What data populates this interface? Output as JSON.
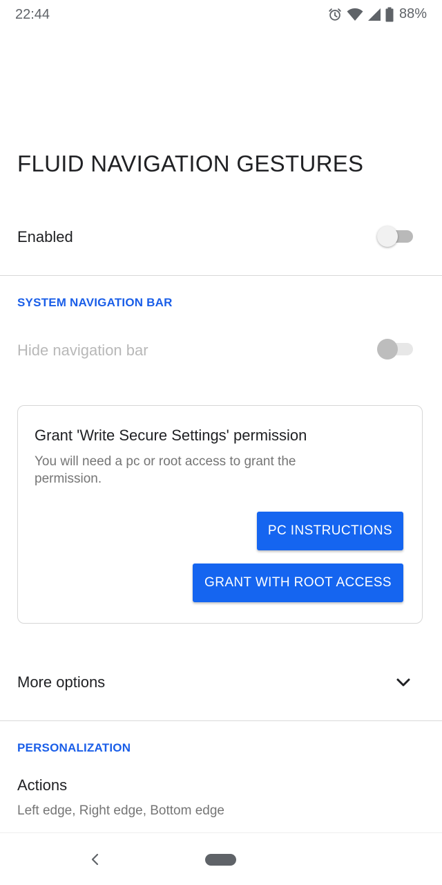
{
  "status_bar": {
    "time": "22:44",
    "battery": "88%",
    "icons": [
      "alarm-icon",
      "wifi-icon",
      "signal-icon",
      "battery-icon"
    ]
  },
  "page": {
    "title": "FLUID NAVIGATION GESTURES"
  },
  "enabled_row": {
    "label": "Enabled",
    "toggle_on": false
  },
  "system_nav": {
    "header": "SYSTEM NAVIGATION BAR",
    "hide_nav_label": "Hide navigation bar",
    "hide_nav_enabled": false,
    "toggle_on": false
  },
  "permission_card": {
    "title": "Grant 'Write Secure Settings' permission",
    "body": "You will need a pc or root access to grant the permission.",
    "pc_button": "PC INSTRUCTIONS",
    "root_button": "GRANT WITH ROOT ACCESS"
  },
  "more_options": {
    "label": "More options",
    "icon": "chevron-down-icon"
  },
  "personalization": {
    "header": "PERSONALIZATION",
    "actions_label": "Actions",
    "actions_summary": "Left edge, Right edge, Bottom edge"
  },
  "colors": {
    "accent": "#1a5ee8",
    "button": "#1565f0",
    "text_primary": "#202124",
    "text_secondary": "#757575",
    "text_disabled": "#b8b8b8"
  }
}
